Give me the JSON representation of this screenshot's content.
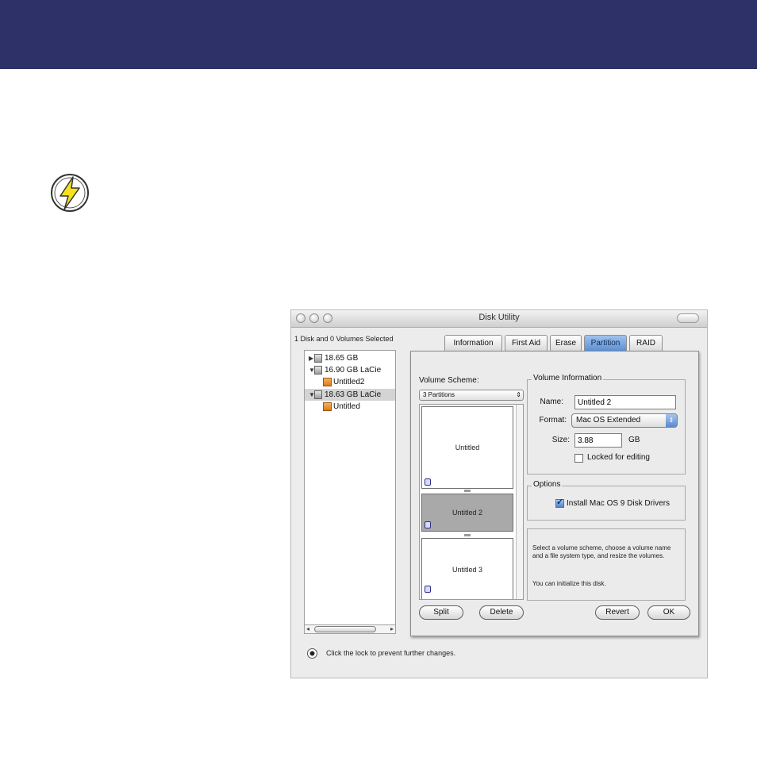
{
  "window": {
    "title": "Disk Utility"
  },
  "selection_label": "1 Disk and 0 Volumes Selected",
  "sidebar": {
    "items": [
      {
        "label": "18.65 GB",
        "type": "disk",
        "expanded": false
      },
      {
        "label": "16.90 GB LaCie",
        "type": "disk",
        "expanded": true
      },
      {
        "label": "Untitled2",
        "type": "volume"
      },
      {
        "label": "18.63 GB LaCie",
        "type": "disk",
        "expanded": true,
        "selected": true
      },
      {
        "label": "Untitled",
        "type": "volume"
      }
    ]
  },
  "tabs": [
    {
      "label": "Information"
    },
    {
      "label": "First Aid"
    },
    {
      "label": "Erase"
    },
    {
      "label": "Partition",
      "active": true
    },
    {
      "label": "RAID"
    }
  ],
  "partition": {
    "volume_scheme_label": "Volume Scheme:",
    "volume_scheme_value": "3 Partitions",
    "partitions": [
      {
        "name": "Untitled"
      },
      {
        "name": "Untitled 2",
        "selected": true
      },
      {
        "name": "Untitled 3"
      }
    ],
    "volume_info_title": "Volume Information",
    "name_label": "Name:",
    "name_value": "Untitled 2",
    "format_label": "Format:",
    "format_value": "Mac OS Extended",
    "size_label": "Size:",
    "size_value": "3.88",
    "size_unit": "GB",
    "locked_label": "Locked for editing",
    "locked_checked": false,
    "options_title": "Options",
    "install_drivers_label": "Install Mac OS 9 Disk Drivers",
    "install_drivers_checked": true,
    "help_text_1": "Select a volume scheme, choose a volume name and a file system type, and resize the volumes.",
    "help_text_2": "You can initialize this disk.",
    "split_label": "Split",
    "delete_label": "Delete",
    "revert_label": "Revert",
    "ok_label": "OK"
  },
  "lock_text": "Click the lock to prevent further changes.",
  "colors": {
    "banner": "#2e3068",
    "active_tab": "#5d8fd3",
    "bolt_yellow": "#f7e21c"
  }
}
